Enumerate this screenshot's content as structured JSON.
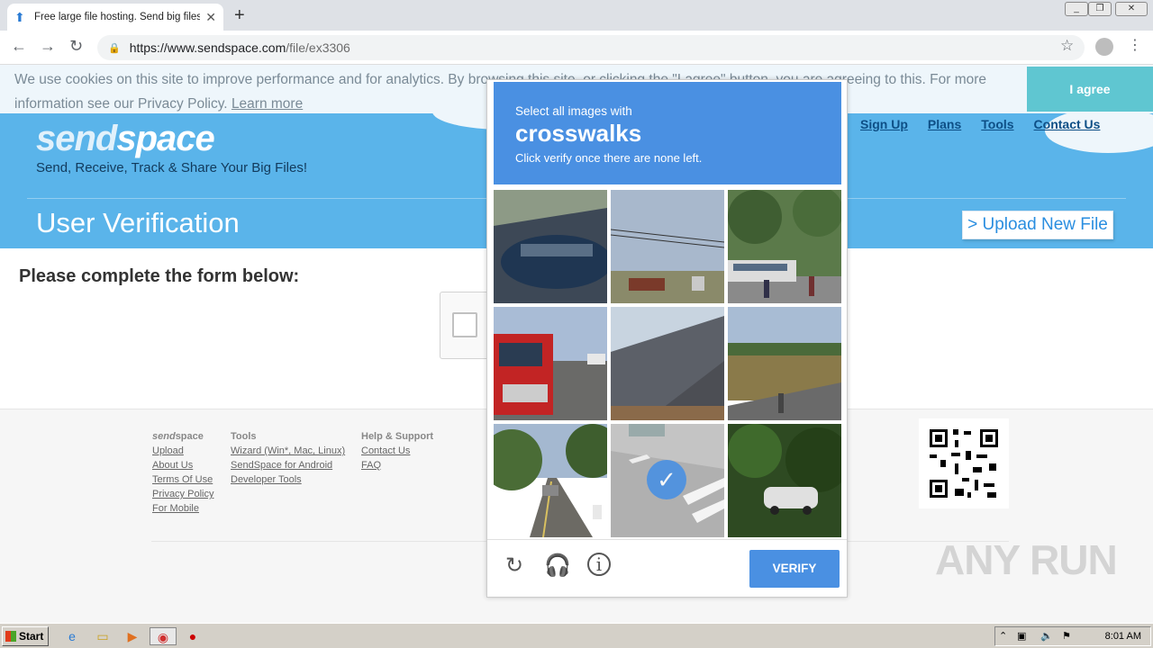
{
  "browser": {
    "tab_title": "Free large file hosting. Send big files",
    "new_tab_symbol": "+",
    "url_host": "https://www.sendspace.com",
    "url_path": "/file/ex3306"
  },
  "cookie_banner": {
    "text_line1": "We use cookies on this site to improve performance and for analytics. By browsing this site, or clicking the \"I agree\" button, you are agreeing to this. For more",
    "text_line2_prefix": "information see our Privacy Policy.",
    "learn_more": "Learn more",
    "agree_button": "I agree"
  },
  "header": {
    "logo_a": "send",
    "logo_b": "space",
    "tagline": "Send, Receive, Track & Share Your Big Files!",
    "nav": [
      "Sign Up",
      "Plans",
      "Tools",
      "Contact Us"
    ],
    "page_title": "User Verification",
    "upload_button": "> Upload New File"
  },
  "main": {
    "form_title": "Please complete the form below:"
  },
  "captcha": {
    "line1": "Select all images with",
    "target": "crosswalks",
    "line3": "Click verify once there are none left.",
    "verify_button": "VERIFY",
    "selected_tile": 7,
    "icons": [
      "reload-icon",
      "audio-icon",
      "info-icon"
    ]
  },
  "footer": {
    "col1": {
      "heading_a": "send",
      "heading_b": "space",
      "links": [
        "Upload",
        "About Us",
        "Terms Of Use",
        "Privacy Policy",
        "For Mobile"
      ]
    },
    "col2": {
      "heading": "Tools",
      "links": [
        "Wizard (Win*, Mac, Linux)",
        "SendSpace for Android",
        "Developer Tools"
      ]
    },
    "col3": {
      "heading": "Help & Support",
      "links": [
        "Contact Us",
        "FAQ"
      ]
    },
    "watermark": "ANY RUN"
  },
  "taskbar": {
    "start": "Start",
    "clock": "8:01 AM"
  },
  "colors": {
    "header_blue": "#5ab4ea",
    "captcha_blue": "#4a90e2",
    "agree_teal": "#5fc6d1"
  }
}
